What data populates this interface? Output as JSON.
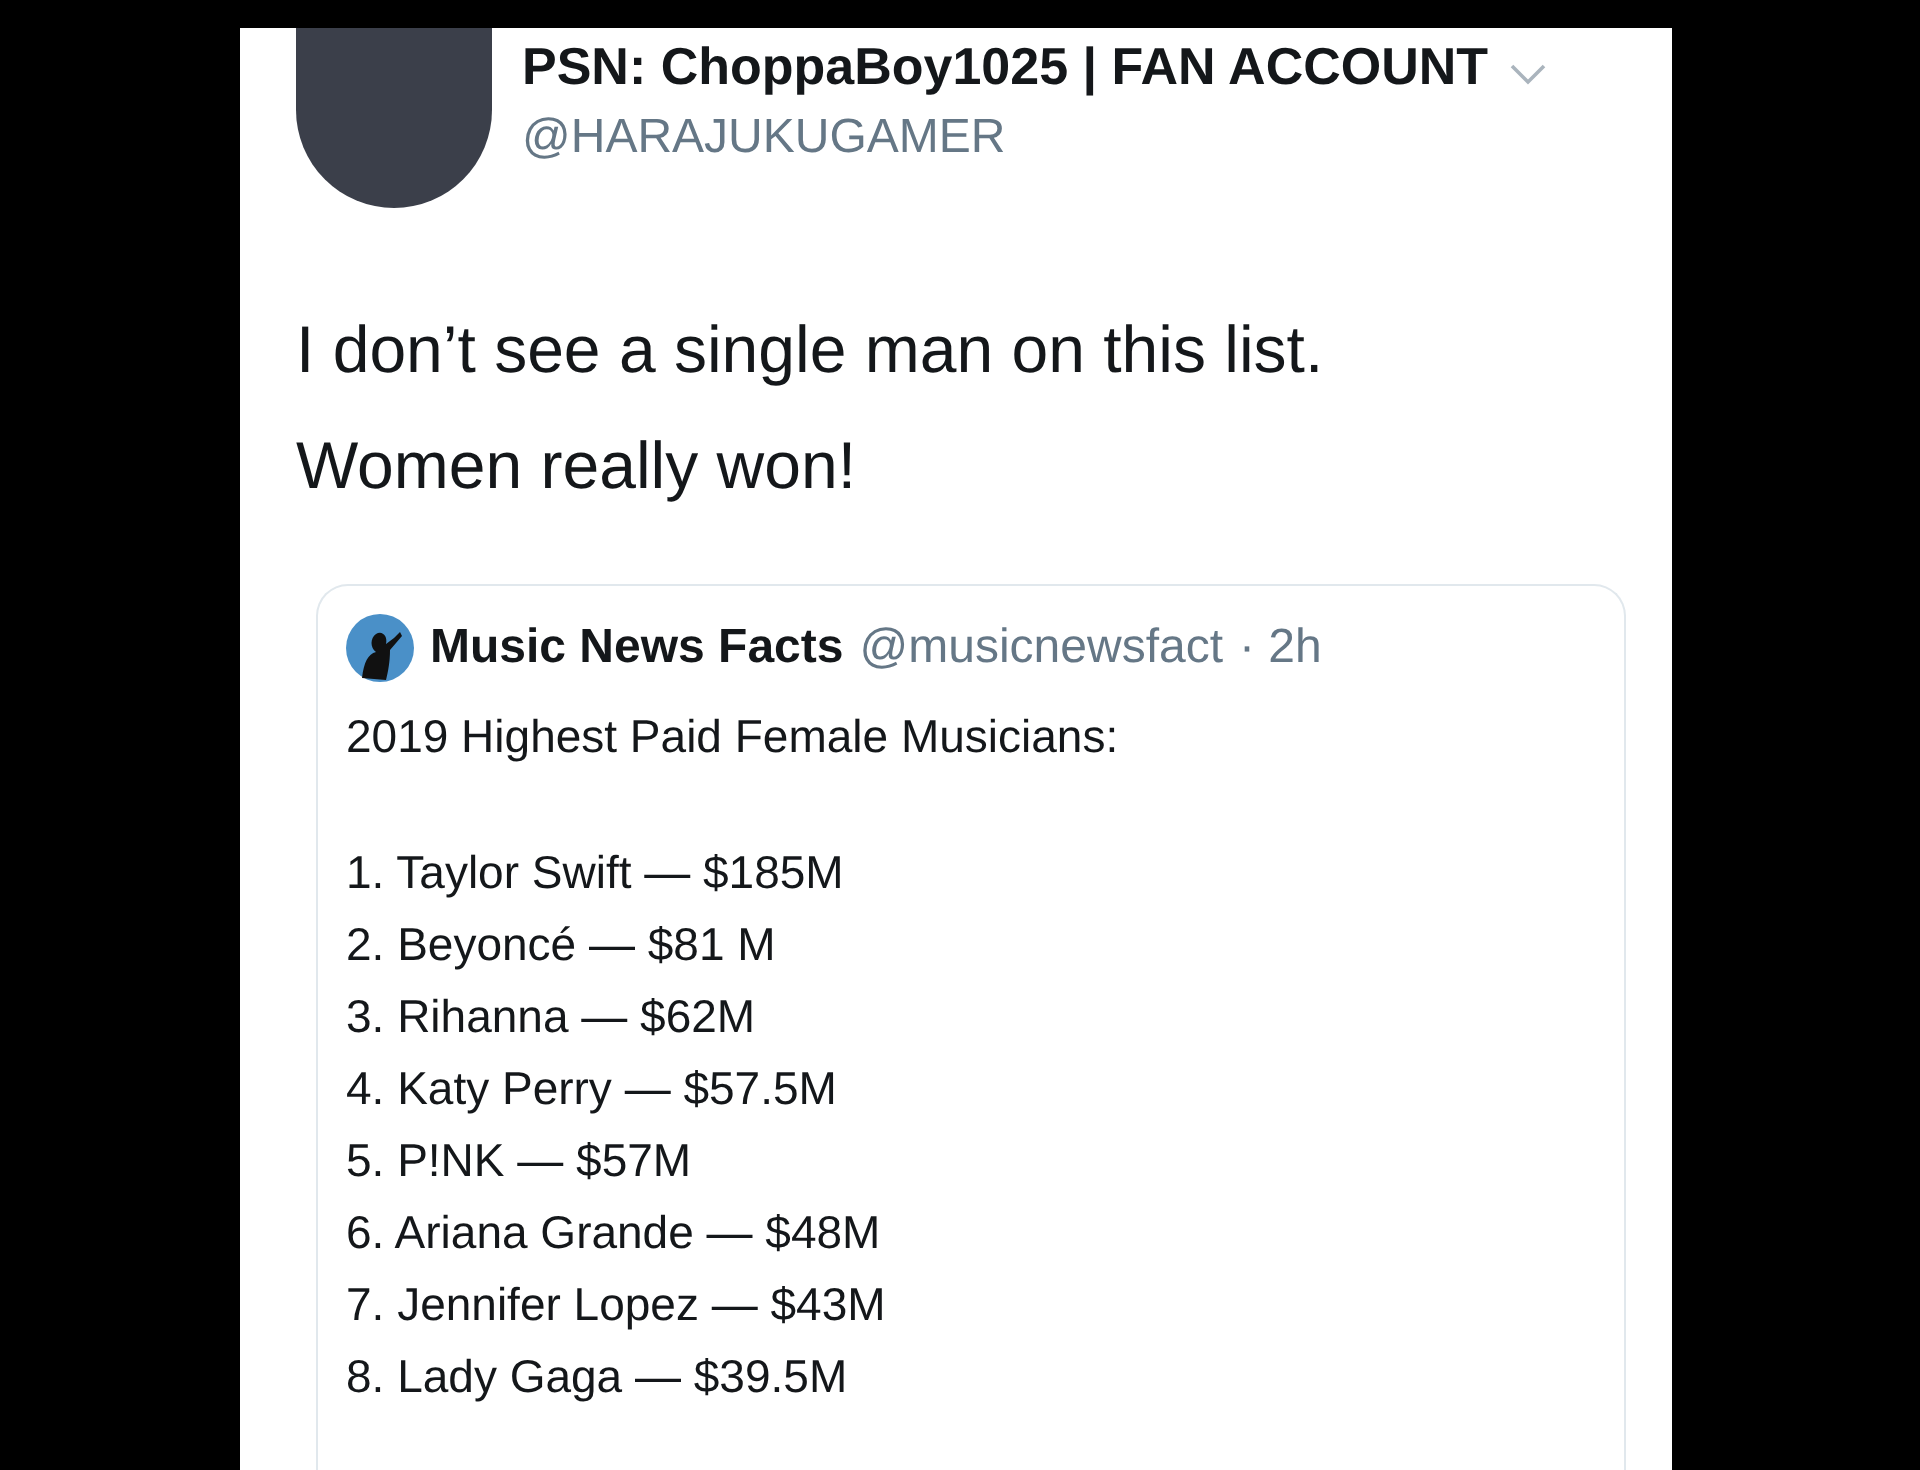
{
  "tweet": {
    "display_name": "PSN: ChoppaBoy1025 | FAN ACCOUNT",
    "handle": "@HARAJUKUGAMER",
    "text_lines": [
      "I don’t see a single man on this list.",
      "Women really won!"
    ],
    "quoted_tweet": {
      "display_name": "Music News Facts",
      "handle": "@musicnewsfact",
      "time": "· 2h",
      "title": "2019 Highest Paid Female Musicians:",
      "list": [
        "1. Taylor Swift — $185M",
        "2. Beyoncé — $81 M",
        "3. Rihanna — $62M",
        "4. Katy Perry — $57.5M",
        "5. P!NK — $57M",
        "6. Ariana Grande — $48M",
        "7. Jennifer Lopez — $43M",
        "8. Lady Gaga — $39.5M"
      ]
    }
  }
}
